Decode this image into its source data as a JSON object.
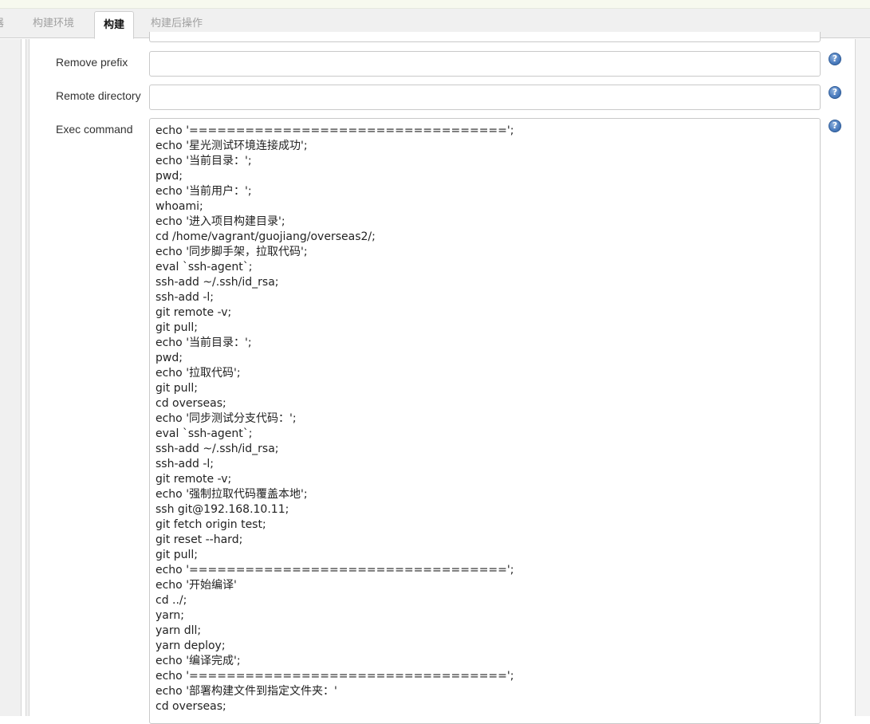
{
  "tabs": [
    {
      "label": "器"
    },
    {
      "label": "构建环境"
    },
    {
      "label": "构建"
    },
    {
      "label": "构建后操作"
    }
  ],
  "active_tab_index": 2,
  "form": {
    "remove_prefix": {
      "label": "Remove prefix",
      "value": ""
    },
    "remote_directory": {
      "label": "Remote directory",
      "value": ""
    },
    "exec_command": {
      "label": "Exec command",
      "lines": [
        "echo '==================================';",
        "echo '星光测试环境连接成功';",
        "echo '当前目录：';",
        "pwd;",
        "echo '当前用户：';",
        "whoami;",
        "echo '进入项目构建目录';",
        "cd /home/vagrant/guojiang/overseas2/;",
        "echo '同步脚手架，拉取代码';",
        "eval `ssh-agent`;",
        "ssh-add ~/.ssh/id_rsa;",
        "ssh-add -l;",
        "git remote -v;",
        "git pull;",
        "echo '当前目录：';",
        "pwd;",
        "echo '拉取代码';",
        "git pull;",
        "cd overseas;",
        "echo '同步测试分支代码：';",
        "eval `ssh-agent`;",
        "ssh-add ~/.ssh/id_rsa;",
        "ssh-add -l;",
        "git remote -v;",
        "echo '强制拉取代码覆盖本地';",
        "ssh git@192.168.10.11;",
        "git fetch origin test;",
        "git reset --hard;",
        "git pull;",
        "echo '==================================';",
        "echo '开始编译'",
        "cd ../;",
        "yarn;",
        "yarn dll;",
        "yarn deploy;",
        "echo '编译完成';",
        "echo '==================================';",
        "echo '部署构建文件到指定文件夹：'",
        "cd overseas;"
      ]
    }
  },
  "help_icon": {
    "glyph": "?",
    "name": "help-icon",
    "color": "#4f7fc0"
  },
  "colors": {
    "tab_bar": "#f0f0f0",
    "active_tab_text": "#111111",
    "inactive_tab_text": "#a0a0a0",
    "label": "#333333",
    "border": "#c9c9c9"
  }
}
